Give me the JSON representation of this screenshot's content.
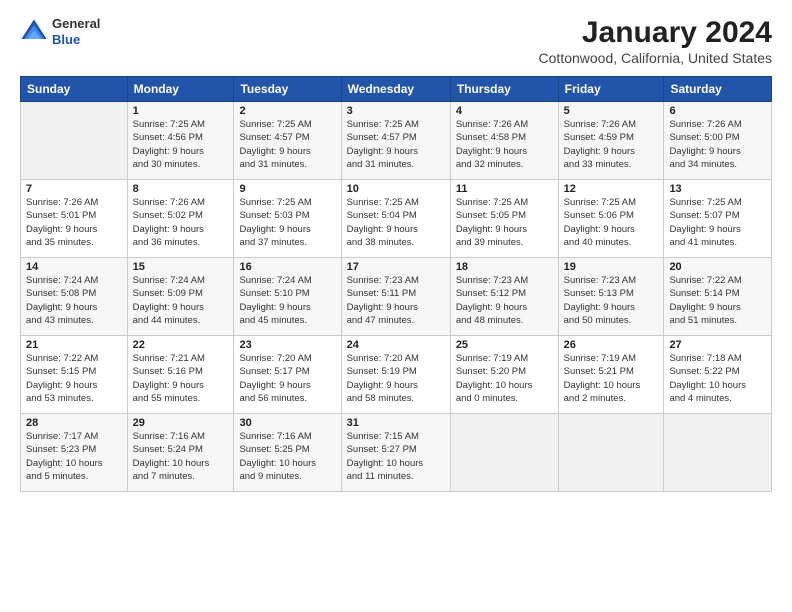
{
  "header": {
    "logo": {
      "general": "General",
      "blue": "Blue"
    },
    "title": "January 2024",
    "subtitle": "Cottonwood, California, United States"
  },
  "days_of_week": [
    "Sunday",
    "Monday",
    "Tuesday",
    "Wednesday",
    "Thursday",
    "Friday",
    "Saturday"
  ],
  "weeks": [
    [
      {
        "day": "",
        "info": ""
      },
      {
        "day": "1",
        "info": "Sunrise: 7:25 AM\nSunset: 4:56 PM\nDaylight: 9 hours\nand 30 minutes."
      },
      {
        "day": "2",
        "info": "Sunrise: 7:25 AM\nSunset: 4:57 PM\nDaylight: 9 hours\nand 31 minutes."
      },
      {
        "day": "3",
        "info": "Sunrise: 7:25 AM\nSunset: 4:57 PM\nDaylight: 9 hours\nand 31 minutes."
      },
      {
        "day": "4",
        "info": "Sunrise: 7:26 AM\nSunset: 4:58 PM\nDaylight: 9 hours\nand 32 minutes."
      },
      {
        "day": "5",
        "info": "Sunrise: 7:26 AM\nSunset: 4:59 PM\nDaylight: 9 hours\nand 33 minutes."
      },
      {
        "day": "6",
        "info": "Sunrise: 7:26 AM\nSunset: 5:00 PM\nDaylight: 9 hours\nand 34 minutes."
      }
    ],
    [
      {
        "day": "7",
        "info": "Sunrise: 7:26 AM\nSunset: 5:01 PM\nDaylight: 9 hours\nand 35 minutes."
      },
      {
        "day": "8",
        "info": "Sunrise: 7:26 AM\nSunset: 5:02 PM\nDaylight: 9 hours\nand 36 minutes."
      },
      {
        "day": "9",
        "info": "Sunrise: 7:25 AM\nSunset: 5:03 PM\nDaylight: 9 hours\nand 37 minutes."
      },
      {
        "day": "10",
        "info": "Sunrise: 7:25 AM\nSunset: 5:04 PM\nDaylight: 9 hours\nand 38 minutes."
      },
      {
        "day": "11",
        "info": "Sunrise: 7:25 AM\nSunset: 5:05 PM\nDaylight: 9 hours\nand 39 minutes."
      },
      {
        "day": "12",
        "info": "Sunrise: 7:25 AM\nSunset: 5:06 PM\nDaylight: 9 hours\nand 40 minutes."
      },
      {
        "day": "13",
        "info": "Sunrise: 7:25 AM\nSunset: 5:07 PM\nDaylight: 9 hours\nand 41 minutes."
      }
    ],
    [
      {
        "day": "14",
        "info": "Sunrise: 7:24 AM\nSunset: 5:08 PM\nDaylight: 9 hours\nand 43 minutes."
      },
      {
        "day": "15",
        "info": "Sunrise: 7:24 AM\nSunset: 5:09 PM\nDaylight: 9 hours\nand 44 minutes."
      },
      {
        "day": "16",
        "info": "Sunrise: 7:24 AM\nSunset: 5:10 PM\nDaylight: 9 hours\nand 45 minutes."
      },
      {
        "day": "17",
        "info": "Sunrise: 7:23 AM\nSunset: 5:11 PM\nDaylight: 9 hours\nand 47 minutes."
      },
      {
        "day": "18",
        "info": "Sunrise: 7:23 AM\nSunset: 5:12 PM\nDaylight: 9 hours\nand 48 minutes."
      },
      {
        "day": "19",
        "info": "Sunrise: 7:23 AM\nSunset: 5:13 PM\nDaylight: 9 hours\nand 50 minutes."
      },
      {
        "day": "20",
        "info": "Sunrise: 7:22 AM\nSunset: 5:14 PM\nDaylight: 9 hours\nand 51 minutes."
      }
    ],
    [
      {
        "day": "21",
        "info": "Sunrise: 7:22 AM\nSunset: 5:15 PM\nDaylight: 9 hours\nand 53 minutes."
      },
      {
        "day": "22",
        "info": "Sunrise: 7:21 AM\nSunset: 5:16 PM\nDaylight: 9 hours\nand 55 minutes."
      },
      {
        "day": "23",
        "info": "Sunrise: 7:20 AM\nSunset: 5:17 PM\nDaylight: 9 hours\nand 56 minutes."
      },
      {
        "day": "24",
        "info": "Sunrise: 7:20 AM\nSunset: 5:19 PM\nDaylight: 9 hours\nand 58 minutes."
      },
      {
        "day": "25",
        "info": "Sunrise: 7:19 AM\nSunset: 5:20 PM\nDaylight: 10 hours\nand 0 minutes."
      },
      {
        "day": "26",
        "info": "Sunrise: 7:19 AM\nSunset: 5:21 PM\nDaylight: 10 hours\nand 2 minutes."
      },
      {
        "day": "27",
        "info": "Sunrise: 7:18 AM\nSunset: 5:22 PM\nDaylight: 10 hours\nand 4 minutes."
      }
    ],
    [
      {
        "day": "28",
        "info": "Sunrise: 7:17 AM\nSunset: 5:23 PM\nDaylight: 10 hours\nand 5 minutes."
      },
      {
        "day": "29",
        "info": "Sunrise: 7:16 AM\nSunset: 5:24 PM\nDaylight: 10 hours\nand 7 minutes."
      },
      {
        "day": "30",
        "info": "Sunrise: 7:16 AM\nSunset: 5:25 PM\nDaylight: 10 hours\nand 9 minutes."
      },
      {
        "day": "31",
        "info": "Sunrise: 7:15 AM\nSunset: 5:27 PM\nDaylight: 10 hours\nand 11 minutes."
      },
      {
        "day": "",
        "info": ""
      },
      {
        "day": "",
        "info": ""
      },
      {
        "day": "",
        "info": ""
      }
    ]
  ]
}
